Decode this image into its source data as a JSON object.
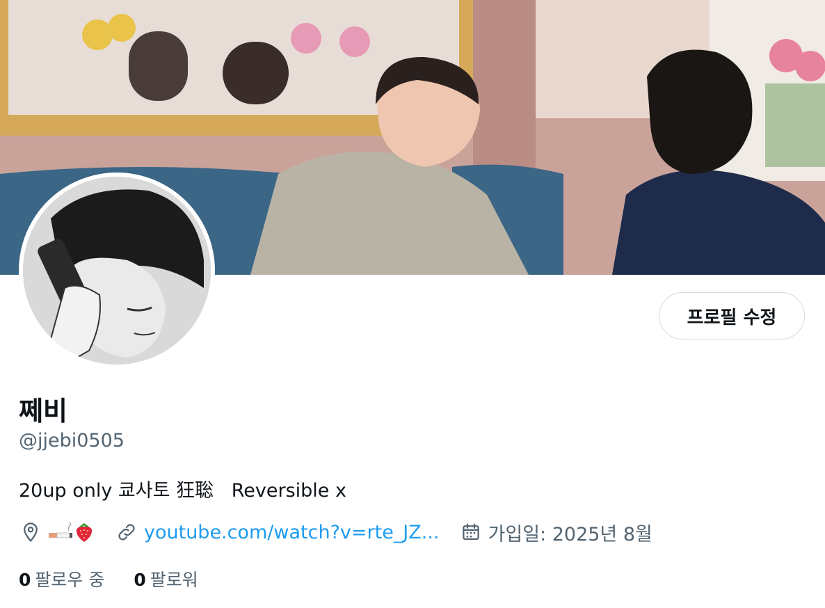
{
  "profile": {
    "display_name": "쩨비",
    "handle": "@jjebi0505",
    "bio": "20up only 쿄사토 狂聡   Reversible x",
    "location_emoji": [
      "cigarette",
      "strawberry"
    ],
    "location_icon": "location-pin-icon",
    "link_text": "youtube.com/watch?v=rte_JZ...",
    "link_icon": "link-icon",
    "joined_text": "가입일: 2025년 8월",
    "joined_icon": "calendar-icon"
  },
  "actions": {
    "edit_profile_label": "프로필 수정"
  },
  "stats": {
    "following_count": "0",
    "following_label": "팔로우 중",
    "followers_count": "0",
    "followers_label": "팔로워"
  },
  "colors": {
    "link": "#1d9bf0",
    "secondary_text": "#536471",
    "primary_text": "#0f1419",
    "button_border": "#cfd9de"
  }
}
